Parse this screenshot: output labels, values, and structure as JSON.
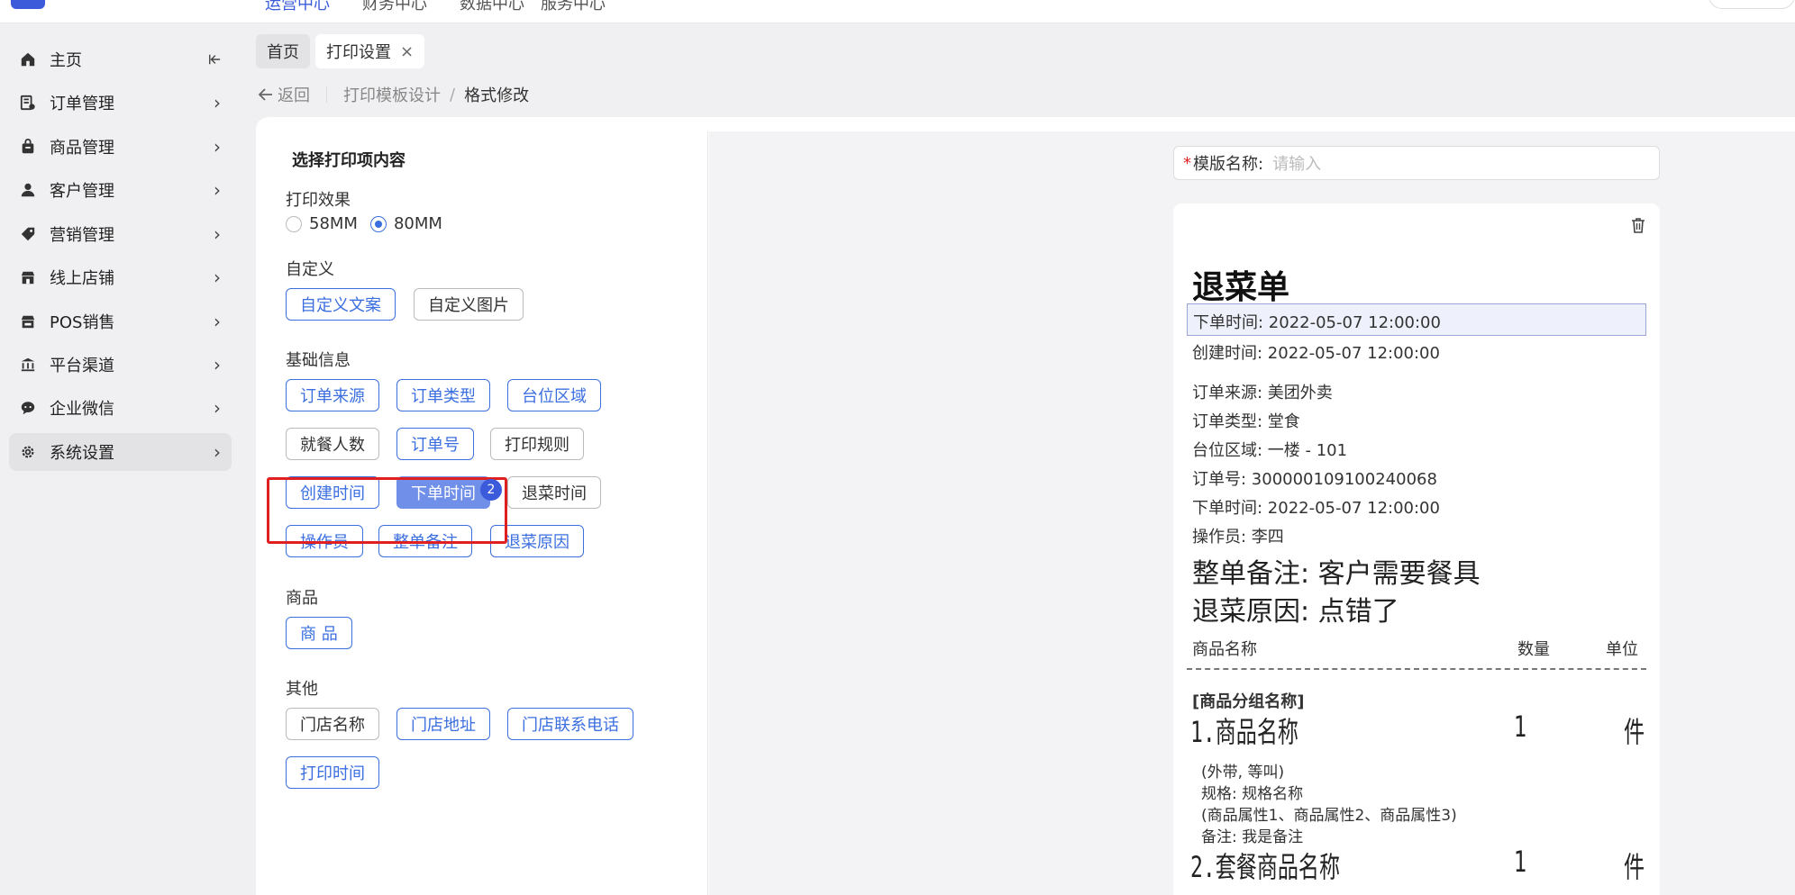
{
  "topbar": {
    "nav": [
      "运营中心",
      "财务中心",
      "数据中心",
      "服务中心"
    ]
  },
  "sidebar": {
    "items": [
      {
        "label": "主页",
        "icon": "home-icon"
      },
      {
        "label": "订单管理",
        "icon": "order-icon"
      },
      {
        "label": "商品管理",
        "icon": "goods-icon"
      },
      {
        "label": "客户管理",
        "icon": "user-icon"
      },
      {
        "label": "营销管理",
        "icon": "tag-icon"
      },
      {
        "label": "线上店铺",
        "icon": "store-icon"
      },
      {
        "label": "POS销售",
        "icon": "pos-icon"
      },
      {
        "label": "平台渠道",
        "icon": "bank-icon"
      },
      {
        "label": "企业微信",
        "icon": "chat-icon"
      },
      {
        "label": "系统设置",
        "icon": "gear-icon"
      }
    ],
    "active_index": 9
  },
  "tabs": [
    {
      "label": "首页"
    },
    {
      "label": "打印设置",
      "closable": true
    }
  ],
  "breadcrumb": {
    "back": "返回",
    "parent": "打印模板设计",
    "separator": "/",
    "current": "格式修改"
  },
  "left": {
    "title": "选择打印项内容",
    "print_effect_label": "打印效果",
    "radio": [
      {
        "label": "58MM",
        "checked": false
      },
      {
        "label": "80MM",
        "checked": true
      }
    ],
    "custom_label": "自定义",
    "custom_chips": [
      "自定义文案",
      "自定义图片"
    ],
    "basic_label": "基础信息",
    "basic_chips": [
      "订单来源",
      "订单类型",
      "台位区域",
      "就餐人数",
      "订单号",
      "打印规则",
      "创建时间",
      "下单时间",
      "退菜时间",
      "操作员",
      "整单备注",
      "退菜原因"
    ],
    "selected_badge": "2",
    "goods_label": "商品",
    "goods_chips": [
      "商 品"
    ],
    "other_label": "其他",
    "other_chips": [
      "门店名称",
      "门店地址",
      "门店联系电话",
      "打印时间"
    ]
  },
  "template_name": {
    "required_mark": "*",
    "label": "模版名称:",
    "placeholder": "请输入"
  },
  "receipt": {
    "title": "退菜单",
    "highlight_line": "下单时间: 2022-05-07 12:00:00",
    "create_time": "创建时间: 2022-05-07 12:00:00",
    "order_source": "订单来源: 美团外卖",
    "order_type": "订单类型: 堂食",
    "table_area": "台位区域: 一楼 - 101",
    "order_no": "订单号: 300000109100240068",
    "order_time": "下单时间: 2022-05-07 12:00:00",
    "operator": "操作员: 李四",
    "remark": "整单备注: 客户需要餐具",
    "reason": "退菜原因: 点错了",
    "col_name": "商品名称",
    "col_qty": "数量",
    "col_unit": "单位",
    "group": "[商品分组名称]",
    "items": [
      {
        "name": "1.商品名称",
        "qty": "1",
        "unit": "件"
      },
      {
        "name": "2.套餐商品名称",
        "qty": "1",
        "unit": "件"
      }
    ],
    "details": [
      "(外带, 等叫)",
      "规格: 规格名称",
      "(商品属性1、商品属性2、商品属性3)",
      "备注: 我是备注"
    ]
  }
}
